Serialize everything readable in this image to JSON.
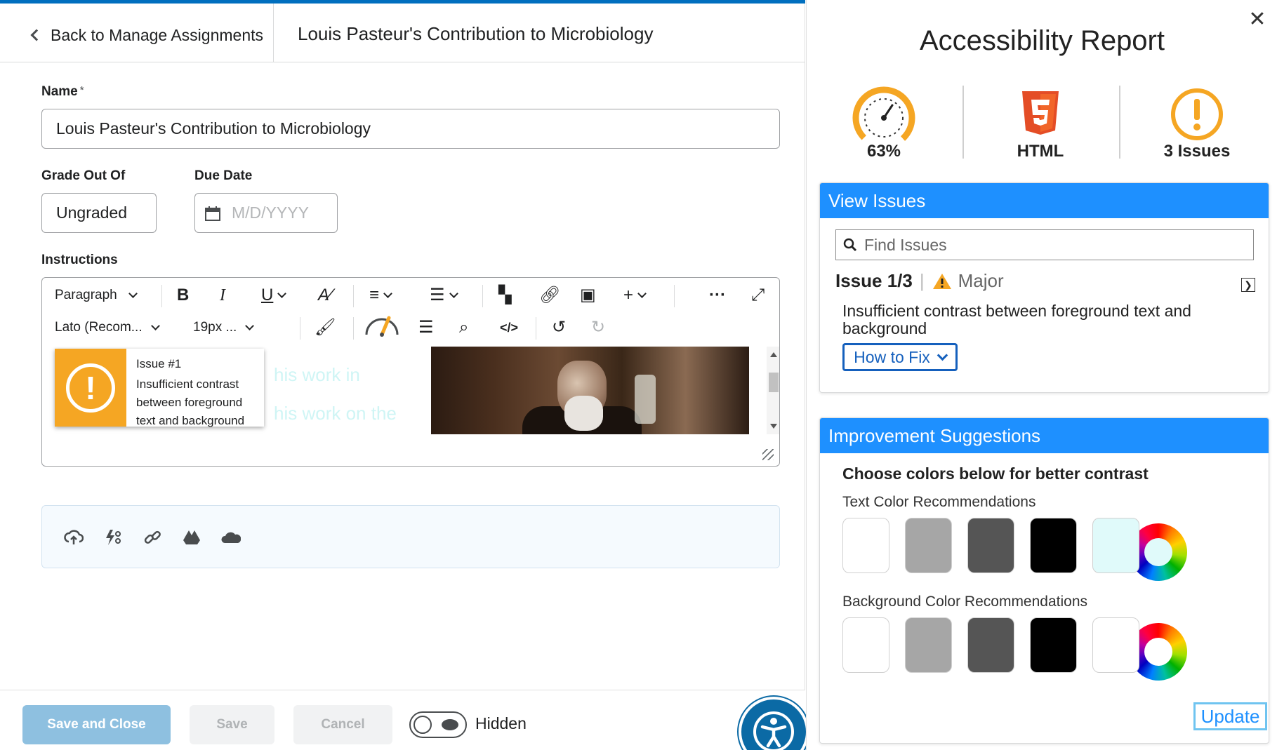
{
  "header": {
    "back_label": "Back to Manage Assignments",
    "title": "Louis Pasteur's Contribution to Microbiology"
  },
  "form": {
    "name_label": "Name",
    "name_required_mark": "*",
    "name_value": "Louis Pasteur's Contribution to Microbiology",
    "grade_label": "Grade Out Of",
    "grade_value": "Ungraded",
    "due_label": "Due Date",
    "due_placeholder": "M/D/YYYY",
    "instructions_label": "Instructions"
  },
  "editor": {
    "block_format": "Paragraph",
    "font_family": "Lato (Recom...",
    "font_size": "19px ...",
    "icons": [
      "bold-icon",
      "italic-icon",
      "underline-icon",
      "spellcheck-icon",
      "align-icon",
      "list-icon",
      "insert-stuff-icon",
      "link-icon",
      "image-icon",
      "add-icon",
      "more-icon",
      "fullscreen-icon",
      "format-painter-icon",
      "accessibility-checker-icon",
      "word-count-icon",
      "find-replace-icon",
      "source-code-icon",
      "undo-icon",
      "redo-icon"
    ],
    "content_fragments": [
      "his work in",
      "his work on the"
    ],
    "issue_popup": {
      "title": "Issue #1",
      "text": "Insufficient contrast between foreground text and background"
    }
  },
  "attachments": {
    "icons": [
      "upload-icon",
      "record-icon",
      "link-icon",
      "google-drive-icon",
      "onedrive-icon"
    ]
  },
  "footer": {
    "save_close": "Save and Close",
    "save": "Save",
    "cancel": "Cancel",
    "visibility_label": "Hidden"
  },
  "report": {
    "title": "Accessibility Report",
    "score": "63%",
    "format": "HTML",
    "issues_count": "3 Issues",
    "view_issues": {
      "heading": "View Issues",
      "search_placeholder": "Find Issues",
      "issue_position": "Issue 1/3",
      "severity": "Major",
      "description": "Insufficient contrast between foreground text and background",
      "how_to_fix": "How to Fix"
    },
    "suggestions": {
      "heading": "Improvement Suggestions",
      "subheading": "Choose colors below for better contrast",
      "text_colors_label": "Text Color Recommendations",
      "text_colors": [
        "#ffffff",
        "#a6a6a6",
        "#555555",
        "#000000",
        "#e0fafa"
      ],
      "text_wheel_center": "#e0fafa",
      "bg_colors_label": "Background Color Recommendations",
      "bg_colors": [
        "#ffffff",
        "#a6a6a6",
        "#555555",
        "#000000",
        "#ffffff"
      ],
      "bg_wheel_center": "#ffffff",
      "update": "Update"
    }
  },
  "colors": {
    "accent": "#1e90ff",
    "warning": "#f5a623",
    "brand_blue": "#006fbf"
  }
}
